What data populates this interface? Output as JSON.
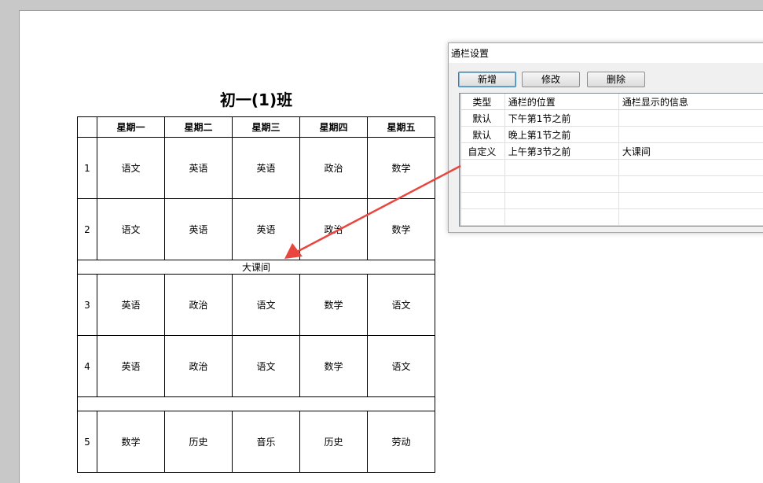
{
  "document": {
    "title": "初一(1)班",
    "days": [
      "星期一",
      "星期二",
      "星期三",
      "星期四",
      "星期五"
    ],
    "rows": [
      {
        "type": "lesson",
        "num": "1",
        "cells": [
          "语文",
          "英语",
          "英语",
          "政治",
          "数学"
        ]
      },
      {
        "type": "lesson",
        "num": "2",
        "cells": [
          "语文",
          "英语",
          "英语",
          "政治",
          "数学"
        ]
      },
      {
        "type": "break",
        "text": "大课间"
      },
      {
        "type": "lesson",
        "num": "3",
        "cells": [
          "英语",
          "政治",
          "语文",
          "数学",
          "语文"
        ]
      },
      {
        "type": "lesson",
        "num": "4",
        "cells": [
          "英语",
          "政治",
          "语文",
          "数学",
          "语文"
        ]
      },
      {
        "type": "break",
        "text": ""
      },
      {
        "type": "lesson",
        "num": "5",
        "cells": [
          "数学",
          "历史",
          "音乐",
          "历史",
          "劳动"
        ]
      }
    ]
  },
  "dialog": {
    "title": "通栏设置",
    "buttons": {
      "add": "新增",
      "edit": "修改",
      "delete": "删除"
    },
    "columns": [
      "类型",
      "通栏的位置",
      "通栏显示的信息"
    ],
    "rows": [
      [
        "默认",
        "下午第1节之前",
        ""
      ],
      [
        "默认",
        "晚上第1节之前",
        ""
      ],
      [
        "自定义",
        "上午第3节之前",
        "大课间"
      ]
    ],
    "empty_rows": 4
  },
  "annotation": {
    "arrow_color": "#e8473f"
  }
}
